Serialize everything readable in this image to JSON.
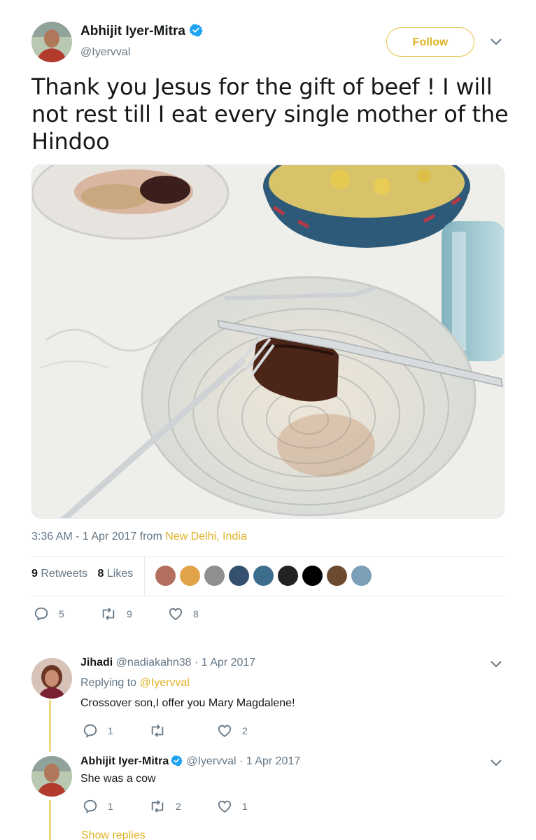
{
  "tweet": {
    "author_name": "Abhijit Iyer-Mitra",
    "author_handle": "@Iyervval",
    "follow_label": "Follow",
    "text": "Thank you Jesus for the gift of beef ! I will not rest till I eat every single mother of the Hindoo",
    "timestamp": "3:36 AM - 1 Apr 2017 from ",
    "location": "New Delhi, India",
    "retweets_count": "9",
    "retweets_label": "Retweets",
    "likes_count": "8",
    "likes_label": "Likes",
    "actions": {
      "replies": "5",
      "retweets": "9",
      "likes": "8"
    }
  },
  "replies": [
    {
      "name": "Jihadi",
      "handle_date": "@nadiakahn38 · 1 Apr 2017",
      "replying_to_label": "Replying to ",
      "replying_to_handle": "@Iyervval",
      "text": "Crossover son,I offer you Mary Magdalene!",
      "actions": {
        "replies": "1",
        "retweets": "",
        "likes": "2"
      }
    },
    {
      "name": "Abhijit Iyer-Mitra",
      "handle_date": "@Iyervval · 1 Apr 2017",
      "text": "She was a cow",
      "actions": {
        "replies": "1",
        "retweets": "2",
        "likes": "1"
      }
    }
  ],
  "show_replies_label": "Show replies",
  "colors": {
    "accent": "#e0b325",
    "secondary_text": "#657786",
    "verified": "#1da1f2"
  },
  "icons": [
    "verified-badge-icon",
    "chevron-down-icon",
    "reply-icon",
    "retweet-icon",
    "like-icon"
  ]
}
